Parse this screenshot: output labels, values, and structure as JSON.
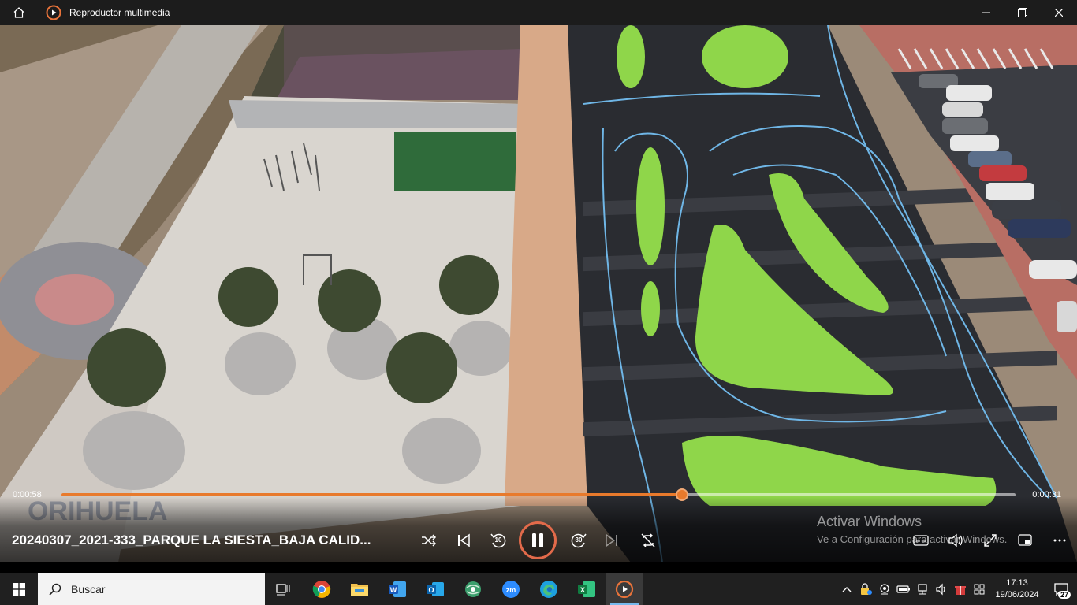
{
  "window": {
    "title": "Reproductor multimedia",
    "icons": [
      "home-icon",
      "media-player-icon",
      "minimize-icon",
      "maximize-icon",
      "close-icon"
    ]
  },
  "player": {
    "current_time": "0:00:58",
    "remaining_time": "0:00:31",
    "progress": 0.65,
    "file_title": "20240307_2021-333_PARQUE LA SIESTA_BAJA CALID...",
    "skip_back_label": "10",
    "skip_forward_label": "30",
    "accent_color": "#e87a2c",
    "controls": [
      "shuffle-icon",
      "previous-icon",
      "skip-back-10-icon",
      "pause-icon",
      "skip-forward-30-icon",
      "next-icon",
      "repeat-off-icon",
      "subtitles-icon",
      "volume-icon",
      "fullscreen-icon",
      "mini-player-icon",
      "more-icon"
    ]
  },
  "watermark": {
    "line1": "Activar Windows",
    "line2": "Ve a Configuración para activar Windows."
  },
  "taskbar": {
    "search_placeholder": "Buscar",
    "apps": [
      "task-view-icon",
      "chrome-icon",
      "file-explorer-icon",
      "word-icon",
      "outlook-icon",
      "network-globe-icon",
      "zoom-icon",
      "edge-icon",
      "excel-icon",
      "media-player-icon"
    ],
    "time": "17:13",
    "date": "19/06/2024",
    "notifications": "27"
  }
}
